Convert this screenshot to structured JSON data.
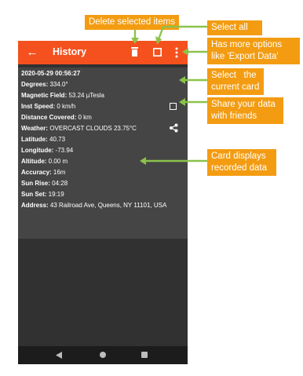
{
  "app": {
    "title": "History",
    "accent_color": "#f4511e",
    "background_color": "#313131",
    "card_color": "#454545",
    "icons": [
      "back-arrow-icon",
      "trash-icon",
      "checkbox-icon",
      "more-vert-icon"
    ]
  },
  "card": {
    "timestamp": "2020-05-29 00:56:27",
    "fields": [
      {
        "label": "Degrees:",
        "value": " 334.0°"
      },
      {
        "label": "Magnetic Field:",
        "value": " 53.24 µTesla"
      },
      {
        "label": "Inst Speed:",
        "value": " 0  km/h"
      },
      {
        "label": "Distance Covered:",
        "value": " 0  km"
      },
      {
        "label": "Weather:",
        "value": " OVERCAST CLOUDS  23.75°C"
      },
      {
        "label": "Latitude:",
        "value": " 40.73"
      },
      {
        "label": "Longitude:",
        "value": " -73.94"
      },
      {
        "label": "Altitude:",
        "value": " 0.00 m"
      },
      {
        "label": "Accuracy:",
        "value": " 16m"
      },
      {
        "label": "Sun Rise:",
        "value": " 04:28"
      },
      {
        "label": "Sun Set:",
        "value": " 19:19"
      },
      {
        "label": "Address:",
        "value": " 43 Railroad Ave, Queens, NY 11101, USA"
      }
    ],
    "icons": [
      "checkbox-icon",
      "share-icon"
    ]
  },
  "nav": {
    "icons": [
      "nav-back-icon",
      "nav-home-icon",
      "nav-recents-icon"
    ]
  },
  "annotations": {
    "color": "#f39c12",
    "arrow_color": "#8bc34a",
    "delete": "Delete selected items",
    "select_all": "Select all",
    "more_options": [
      "Has more options",
      "like 'Export Data'"
    ],
    "select_card": [
      "Select   the",
      "current card"
    ],
    "share": [
      "Share your data",
      "with friends"
    ],
    "card_desc": [
      "Card displays",
      "recorded data"
    ]
  }
}
